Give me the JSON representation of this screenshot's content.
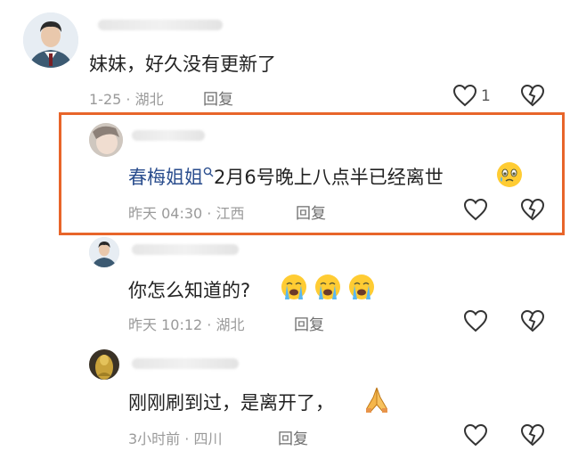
{
  "comments": [
    {
      "text": "妹妹，好久没有更新了",
      "meta": "1-25 · 湖北",
      "reply": "回复",
      "like_count": "1",
      "avatar": "uniform-man-avatar"
    },
    {
      "mention": "春梅姐姐",
      "text": "2月6号晚上八点半已经离世",
      "meta": "昨天 04:30 · 江西",
      "reply": "回复",
      "avatar": "baby-avatar",
      "emoji": "crying-face-emoji",
      "highlighted": true,
      "highlight_color": "#e8652a"
    },
    {
      "text": "你怎么知道的?",
      "meta": "昨天 10:12 · 湖北",
      "reply": "回复",
      "avatar": "uniform-man-avatar",
      "emoji": "loudly-crying-face-emoji"
    },
    {
      "text": "刚刚刷到过，是离开了，",
      "meta": "3小时前 · 四川",
      "reply": "回复",
      "avatar": "golden-statue-avatar",
      "emoji": "folded-hands-emoji"
    }
  ],
  "colors": {
    "mention": "#2b4e8e",
    "text": "#222222",
    "meta": "#9a9a9a",
    "highlight": "#e8652a"
  },
  "icons": [
    "heart-icon",
    "broken-heart-icon",
    "search-icon"
  ]
}
